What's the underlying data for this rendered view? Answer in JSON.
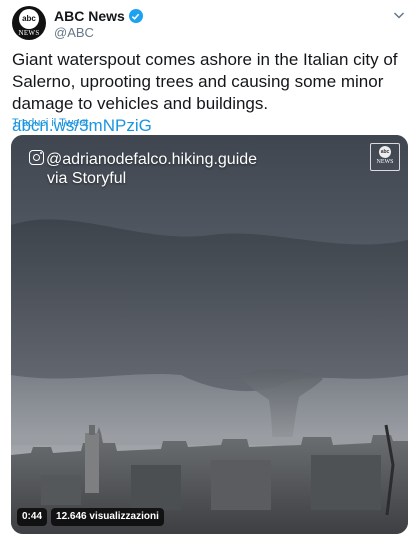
{
  "account": {
    "display_name": "ABC News",
    "handle": "@ABC",
    "avatar_top": "abc",
    "avatar_bottom": "NEWS"
  },
  "tweet": {
    "text": "Giant waterspout comes ashore in the Italian city of Salerno, uprooting trees and causing some minor damage to vehicles and buildings.",
    "link": "abcn.ws/3mNPziG",
    "translate": "Traduci il Tweet"
  },
  "media": {
    "credit_handle": "@adrianodefalco.hiking.guide",
    "credit_via": "via Storyful",
    "watermark_top": "abc",
    "watermark_bottom": "NEWS",
    "duration": "0:44",
    "views": "12.646 visualizzazioni"
  },
  "icons": {
    "verified": "verified-badge-icon",
    "menu": "chevron-down-icon",
    "instagram": "instagram-icon"
  },
  "colors": {
    "link": "#1b95e0",
    "verified": "#1da1f2",
    "secondary_text": "#657786"
  }
}
